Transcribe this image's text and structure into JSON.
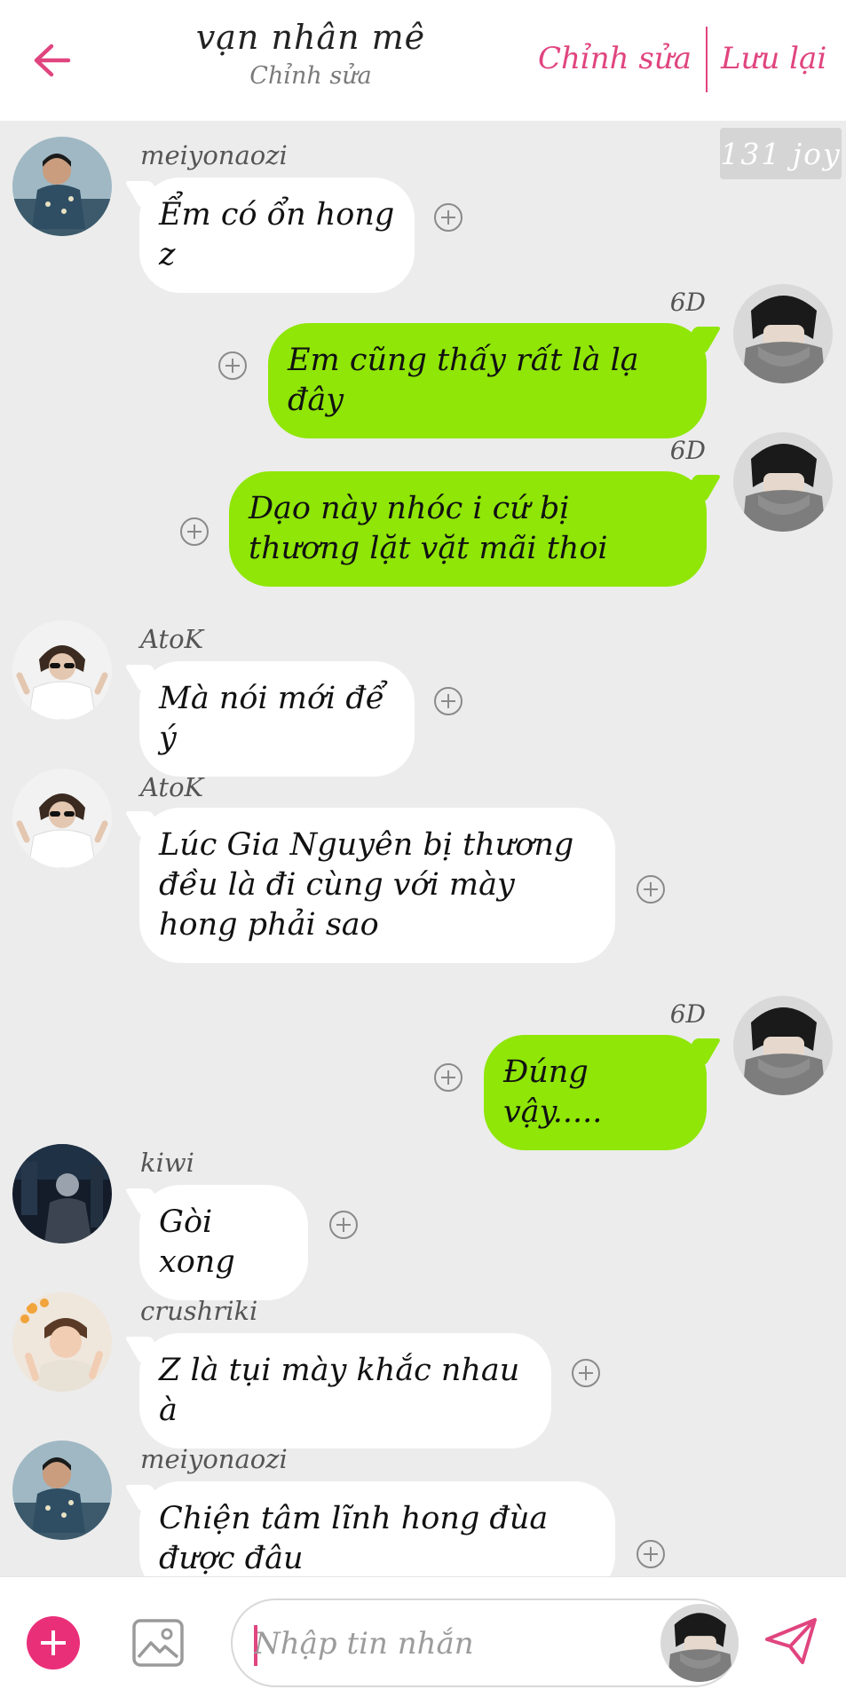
{
  "header": {
    "title": "vạn nhân mê",
    "subtitle": "Chỉnh sửa",
    "edit_label": "Chỉnh sửa",
    "save_label": "Lưu lại",
    "back_icon": "arrow-left-icon"
  },
  "badge": {
    "text": "131 joy"
  },
  "messages": [
    {
      "direction": "in",
      "sender": "meiyonaozi",
      "text": "Ểm có ổn hong z",
      "avatar": "avatar-meiyonaozi"
    },
    {
      "direction": "out",
      "sender": "6D",
      "text": "Em cũng thấy rất là lạ đây",
      "avatar": "avatar-6d"
    },
    {
      "direction": "out",
      "sender": "6D",
      "text": "Dạo này nhóc i cứ bị thương lặt vặt mãi thoi",
      "avatar": "avatar-6d"
    },
    {
      "direction": "in",
      "sender": "AtoK",
      "text": "Mà nói mới để ý",
      "avatar": "avatar-atok"
    },
    {
      "direction": "in",
      "sender": "AtoK",
      "text": "Lúc Gia Nguyên bị thương đều là đi cùng với mày hong phải sao",
      "avatar": "avatar-atok"
    },
    {
      "direction": "out",
      "sender": "6D",
      "text": "Đúng vậy.....",
      "avatar": "avatar-6d"
    },
    {
      "direction": "in",
      "sender": "kiwi",
      "text": "Gòi xong",
      "avatar": "avatar-kiwi"
    },
    {
      "direction": "in",
      "sender": "crushriki",
      "text": "Z là tụi mày khắc nhau à",
      "avatar": "avatar-crushriki"
    },
    {
      "direction": "in",
      "sender": "meiyonaozi",
      "text": "Chiện tâm lĩnh hong đùa được đâu",
      "avatar": "avatar-meiyonaozi"
    }
  ],
  "composer": {
    "placeholder": "Nhập tin nhắn",
    "value": ""
  },
  "colors": {
    "accent": "#e0457f",
    "add_button": "#ea2f79",
    "outgoing_bubble": "#8fe607",
    "incoming_bubble": "#ffffff",
    "background": "#ececec"
  }
}
